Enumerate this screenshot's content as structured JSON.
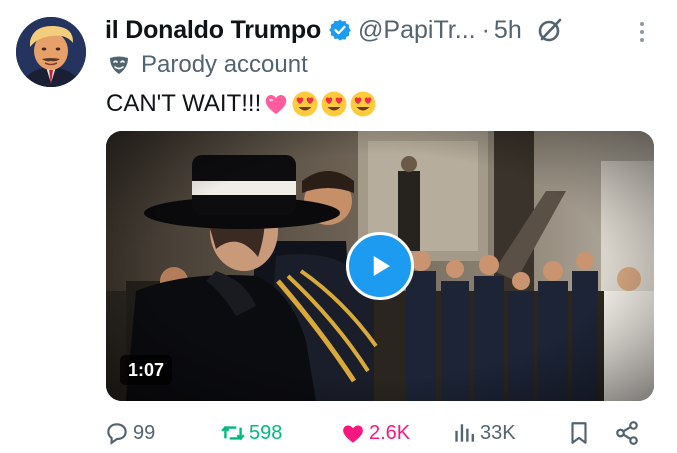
{
  "tweet": {
    "display_name": "il Donaldo Trumpo",
    "handle": "@PapiTr...",
    "separator": "·",
    "time": "5h",
    "parody_label": "Parody account",
    "text": "CAN'T WAIT!!!",
    "emojis": [
      "pink-heart",
      "heart-eyes",
      "heart-eyes",
      "heart-eyes"
    ],
    "verified_color": "#1d9bf0"
  },
  "media": {
    "type": "video",
    "duration": "1:07",
    "play_button_color": "#1d9bf0"
  },
  "actions": {
    "replies": "99",
    "reposts": "598",
    "likes": "2.6K",
    "views": "33K",
    "repost_color": "#00ba7c",
    "like_color": "#f91880"
  },
  "icons": [
    "verified-badge-icon",
    "grok-icon",
    "more-icon",
    "parody-mask-icon",
    "reply-icon",
    "repost-icon",
    "like-icon",
    "views-icon",
    "bookmark-icon",
    "share-icon"
  ]
}
